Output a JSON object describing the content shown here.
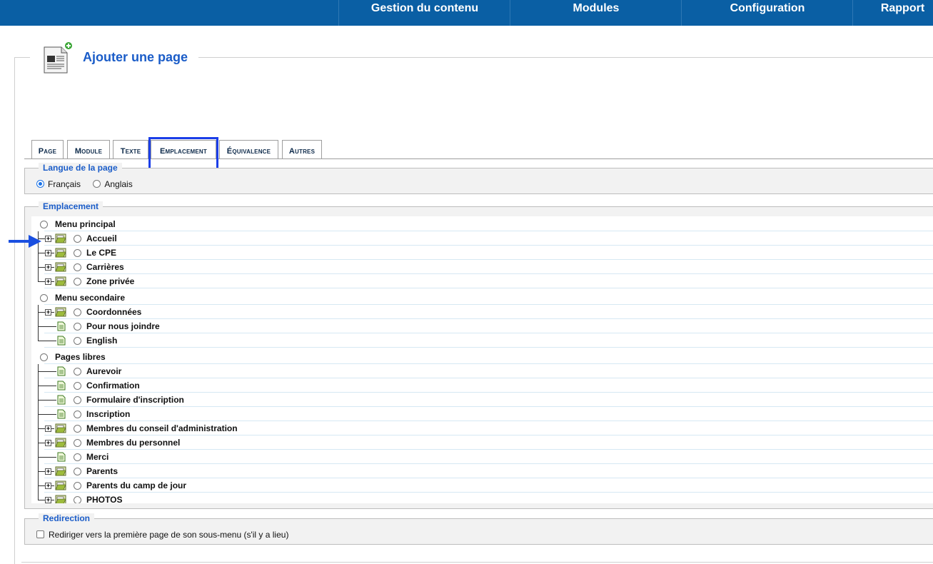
{
  "nav": {
    "items": [
      "Gestion du contenu",
      "Modules",
      "Configuration",
      "Rapport"
    ]
  },
  "page": {
    "title": "Ajouter une page"
  },
  "tabs": [
    "Page",
    "Module",
    "Texte",
    "Emplacement",
    "Équivalence",
    "Autres"
  ],
  "active_tab": "Emplacement",
  "language": {
    "legend": "Langue de la page",
    "options": [
      "Français",
      "Anglais"
    ],
    "selected": "Français"
  },
  "location": {
    "legend": "Emplacement",
    "groups": [
      {
        "label": "Menu principal",
        "items": [
          {
            "label": "Accueil",
            "type": "folder"
          },
          {
            "label": "Le CPE",
            "type": "folder"
          },
          {
            "label": "Carrières",
            "type": "folder"
          },
          {
            "label": "Zone privée",
            "type": "folder"
          }
        ]
      },
      {
        "label": "Menu secondaire",
        "items": [
          {
            "label": "Coordonnées",
            "type": "folder"
          },
          {
            "label": "Pour nous joindre",
            "type": "page"
          },
          {
            "label": "English",
            "type": "page"
          }
        ]
      },
      {
        "label": "Pages libres",
        "items": [
          {
            "label": "Aurevoir",
            "type": "page"
          },
          {
            "label": "Confirmation",
            "type": "page"
          },
          {
            "label": "Formulaire d'inscription",
            "type": "page"
          },
          {
            "label": "Inscription",
            "type": "page"
          },
          {
            "label": "Membres du conseil d'administration",
            "type": "folder"
          },
          {
            "label": "Membres du personnel",
            "type": "folder"
          },
          {
            "label": "Merci",
            "type": "page"
          },
          {
            "label": "Parents",
            "type": "folder"
          },
          {
            "label": "Parents du camp de jour",
            "type": "folder"
          },
          {
            "label": "PHOTOS",
            "type": "folder"
          }
        ]
      }
    ]
  },
  "redirection": {
    "legend": "Redirection",
    "checkbox_label": "Rediriger vers la première page de son sous-menu (s'il y a lieu)",
    "checked": false
  },
  "colors": {
    "nav_bg": "#0a5fa4",
    "title": "#1a5cc8",
    "tab_highlight": "#1b3ee8",
    "arrow": "#1a4fe0"
  }
}
